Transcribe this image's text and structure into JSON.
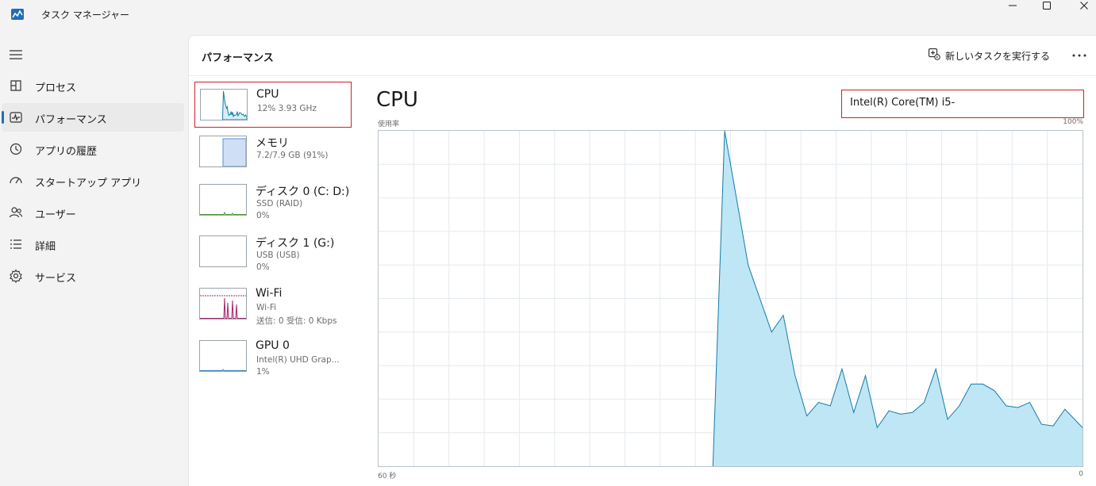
{
  "window": {
    "title": "タスク マネージャー",
    "app_icon": "task-manager-icon",
    "controls": [
      "minimize-icon",
      "maximize-icon",
      "close-icon"
    ]
  },
  "sidebar": {
    "menu_icon": "hamburger-icon",
    "items": [
      {
        "label": "プロセス",
        "icon": "processes-grid-icon",
        "active": false
      },
      {
        "label": "パフォーマンス",
        "icon": "performance-pulse-icon",
        "active": true
      },
      {
        "label": "アプリの履歴",
        "icon": "history-clock-icon",
        "active": false
      },
      {
        "label": "スタートアップ アプリ",
        "icon": "startup-gauge-icon",
        "active": false
      },
      {
        "label": "ユーザー",
        "icon": "users-icon",
        "active": false
      },
      {
        "label": "詳細",
        "icon": "details-list-icon",
        "active": false
      },
      {
        "label": "サービス",
        "icon": "services-gear-icon",
        "active": false
      }
    ]
  },
  "header": {
    "title": "パフォーマンス",
    "run_task_label": "新しいタスクを実行する",
    "more_icon": "more-dots-icon"
  },
  "devices": [
    {
      "name": "CPU",
      "line1": "12%  3.93 GHz",
      "line2": "",
      "selected": true,
      "color": "#117da8"
    },
    {
      "name": "メモリ",
      "line1": "7.2/7.9 GB (91%)",
      "line2": "",
      "selected": false,
      "color": "#5a8fd6"
    },
    {
      "name": "ディスク 0 (C: D:)",
      "line1": "SSD (RAID)",
      "line2": "0%",
      "selected": false,
      "color": "#4d9a2b"
    },
    {
      "name": "ディスク 1 (G:)",
      "line1": "USB (USB)",
      "line2": "0%",
      "selected": false,
      "color": "#4d9a2b"
    },
    {
      "name": "Wi-Fi",
      "line1": "Wi-Fi",
      "line2": "送信: 0 受信: 0 Kbps",
      "selected": false,
      "color": "#a8246b"
    },
    {
      "name": "GPU 0",
      "line1": "Intel(R) UHD Grap...",
      "line2": "1%",
      "selected": false,
      "color": "#2f7fbf"
    }
  ],
  "detail": {
    "title": "CPU",
    "cpu_model": "Intel(R) Core(TM) i5-",
    "y_axis_label": "使用率",
    "y_max_label": "100%",
    "x_start_label": "60 秒",
    "x_end_label": "0"
  },
  "chart_data": {
    "type": "area",
    "title": "",
    "xlabel": "",
    "ylabel": "使用率",
    "xlim": [
      60,
      0
    ],
    "ylim": [
      0,
      100
    ],
    "grid": true,
    "color": "#117da8",
    "fill": "#bfe6f5",
    "series": [
      {
        "x": [
          31.5,
          30.5,
          28.5,
          26.5,
          25.5,
          24.5,
          23.5,
          22.5,
          21.5,
          20.5,
          19.5,
          18.5,
          17.5,
          16.5,
          15.5,
          14.5,
          13.5,
          12.5,
          11.5,
          10.5,
          9.5,
          8.5,
          7.5,
          6.5,
          5.5,
          4.5,
          3.5,
          2.5,
          1.5,
          0
        ],
        "y": [
          0,
          100,
          60,
          40,
          45,
          27,
          15,
          19,
          18,
          29,
          16,
          27,
          11.5,
          16.5,
          15.5,
          16,
          19,
          29,
          14,
          18,
          24.5,
          24.5,
          22.5,
          18,
          17.5,
          19,
          12.5,
          12,
          17,
          11.5
        ]
      }
    ]
  }
}
